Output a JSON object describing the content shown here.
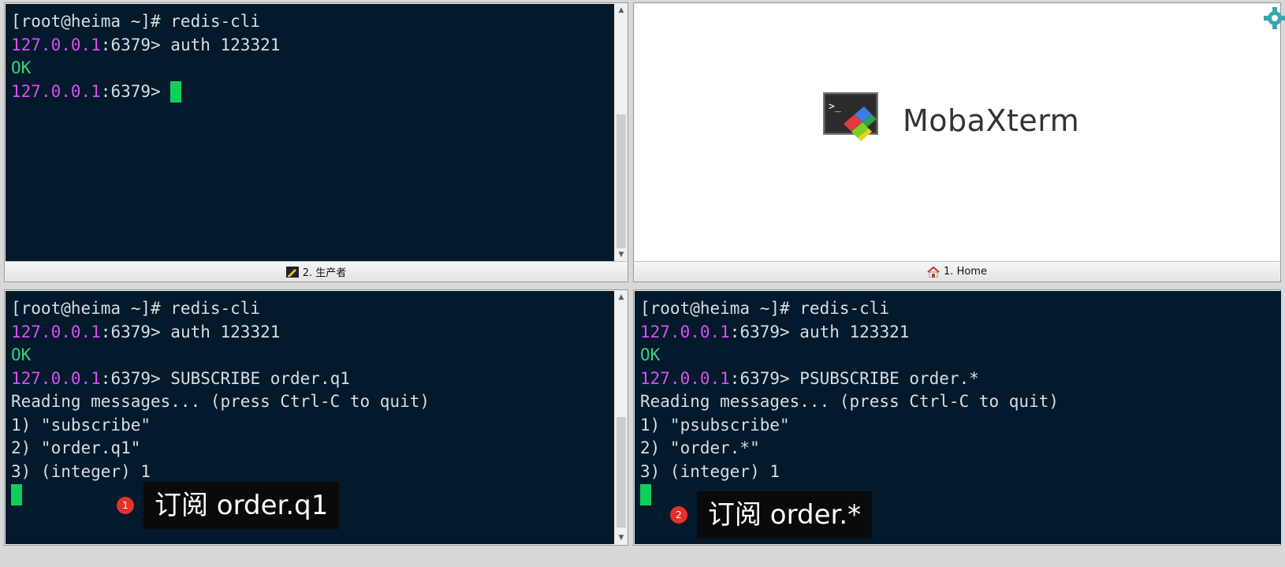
{
  "panes": {
    "top_left": {
      "lines": [
        {
          "a": "",
          "b": "[root@heima ~]# redis-cli",
          "cls": ""
        },
        {
          "a": "127.0.0.1",
          "b": ":6379> auth 123321",
          "cls": "prompt"
        },
        {
          "a": "",
          "b": "OK",
          "cls": "ok"
        },
        {
          "a": "127.0.0.1",
          "b": ":6379> ",
          "cls": "prompt"
        }
      ],
      "tab_label": "2. 生产者"
    },
    "top_right": {
      "app_name": "MobaXterm",
      "tab_label": "1. Home"
    },
    "bottom_left": {
      "lines": [
        {
          "a": "",
          "b": "[root@heima ~]# redis-cli",
          "cls": ""
        },
        {
          "a": "127.0.0.1",
          "b": ":6379> auth 123321",
          "cls": "prompt"
        },
        {
          "a": "",
          "b": "OK",
          "cls": "ok"
        },
        {
          "a": "127.0.0.1",
          "b": ":6379> SUBSCRIBE order.q1",
          "cls": "prompt"
        },
        {
          "a": "",
          "b": "Reading messages... (press Ctrl-C to quit)",
          "cls": ""
        },
        {
          "a": "",
          "b": "1) \"subscribe\"",
          "cls": ""
        },
        {
          "a": "",
          "b": "2) \"order.q1\"",
          "cls": ""
        },
        {
          "a": "",
          "b": "3) (integer) 1",
          "cls": ""
        }
      ],
      "badge": "1",
      "caption": "订阅 order.q1"
    },
    "bottom_right": {
      "lines": [
        {
          "a": "",
          "b": "[root@heima ~]# redis-cli",
          "cls": ""
        },
        {
          "a": "127.0.0.1",
          "b": ":6379> auth 123321",
          "cls": "prompt"
        },
        {
          "a": "",
          "b": "OK",
          "cls": "ok"
        },
        {
          "a": "127.0.0.1",
          "b": ":6379> PSUBSCRIBE order.*",
          "cls": "prompt"
        },
        {
          "a": "",
          "b": "Reading messages... (press Ctrl-C to quit)",
          "cls": ""
        },
        {
          "a": "",
          "b": "1) \"psubscribe\"",
          "cls": ""
        },
        {
          "a": "",
          "b": "2) \"order.*\"",
          "cls": ""
        },
        {
          "a": "",
          "b": "3) (integer) 1",
          "cls": ""
        }
      ],
      "badge": "2",
      "caption": "订阅 order.*"
    }
  },
  "colors": {
    "terminal_bg": "#021a2c",
    "prompt_ip": "#d94ff0",
    "ok_text": "#36d37c",
    "cursor": "#0fd05a"
  },
  "icons": {
    "settings": "gear-icon",
    "producer_tab": "pencil-icon",
    "home_tab": "home-icon",
    "app_logo": "mobaxterm-logo"
  }
}
